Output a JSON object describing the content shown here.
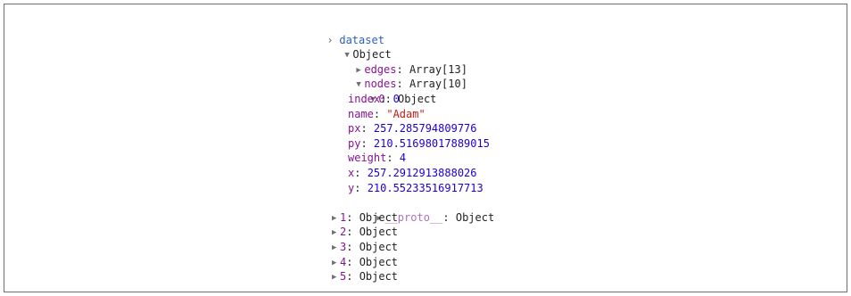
{
  "console": {
    "prompt_glyph": "›",
    "command": "dataset",
    "root": {
      "label": "Object",
      "expanded_glyph": "▼",
      "collapsed_glyph": "▶"
    },
    "edges": {
      "key": "edges",
      "value": "Array[13]"
    },
    "nodes": {
      "key": "nodes",
      "value": "Array[10]"
    },
    "node0": {
      "key": "0",
      "value": "Object",
      "props": [
        {
          "key": "index",
          "value": "0",
          "type": "num"
        },
        {
          "key": "name",
          "value": "\"Adam\"",
          "type": "str"
        },
        {
          "key": "px",
          "value": "257.285794809776",
          "type": "num"
        },
        {
          "key": "py",
          "value": "210.51698017889015",
          "type": "num"
        },
        {
          "key": "weight",
          "value": "4",
          "type": "num"
        },
        {
          "key": "x",
          "value": "257.2912913888026",
          "type": "num"
        },
        {
          "key": "y",
          "value": "210.55233516917713",
          "type": "num"
        }
      ],
      "proto": {
        "key": "__proto__",
        "value": "Object"
      }
    },
    "collapsed_nodes": [
      {
        "key": "1",
        "value": "Object"
      },
      {
        "key": "2",
        "value": "Object"
      },
      {
        "key": "3",
        "value": "Object"
      },
      {
        "key": "4",
        "value": "Object"
      },
      {
        "key": "5",
        "value": "Object"
      }
    ]
  },
  "colors": {
    "command": "#2a5fbf",
    "key": "#881391",
    "number": "#1c00cf",
    "string": "#c41a16",
    "text": "#222222"
  }
}
